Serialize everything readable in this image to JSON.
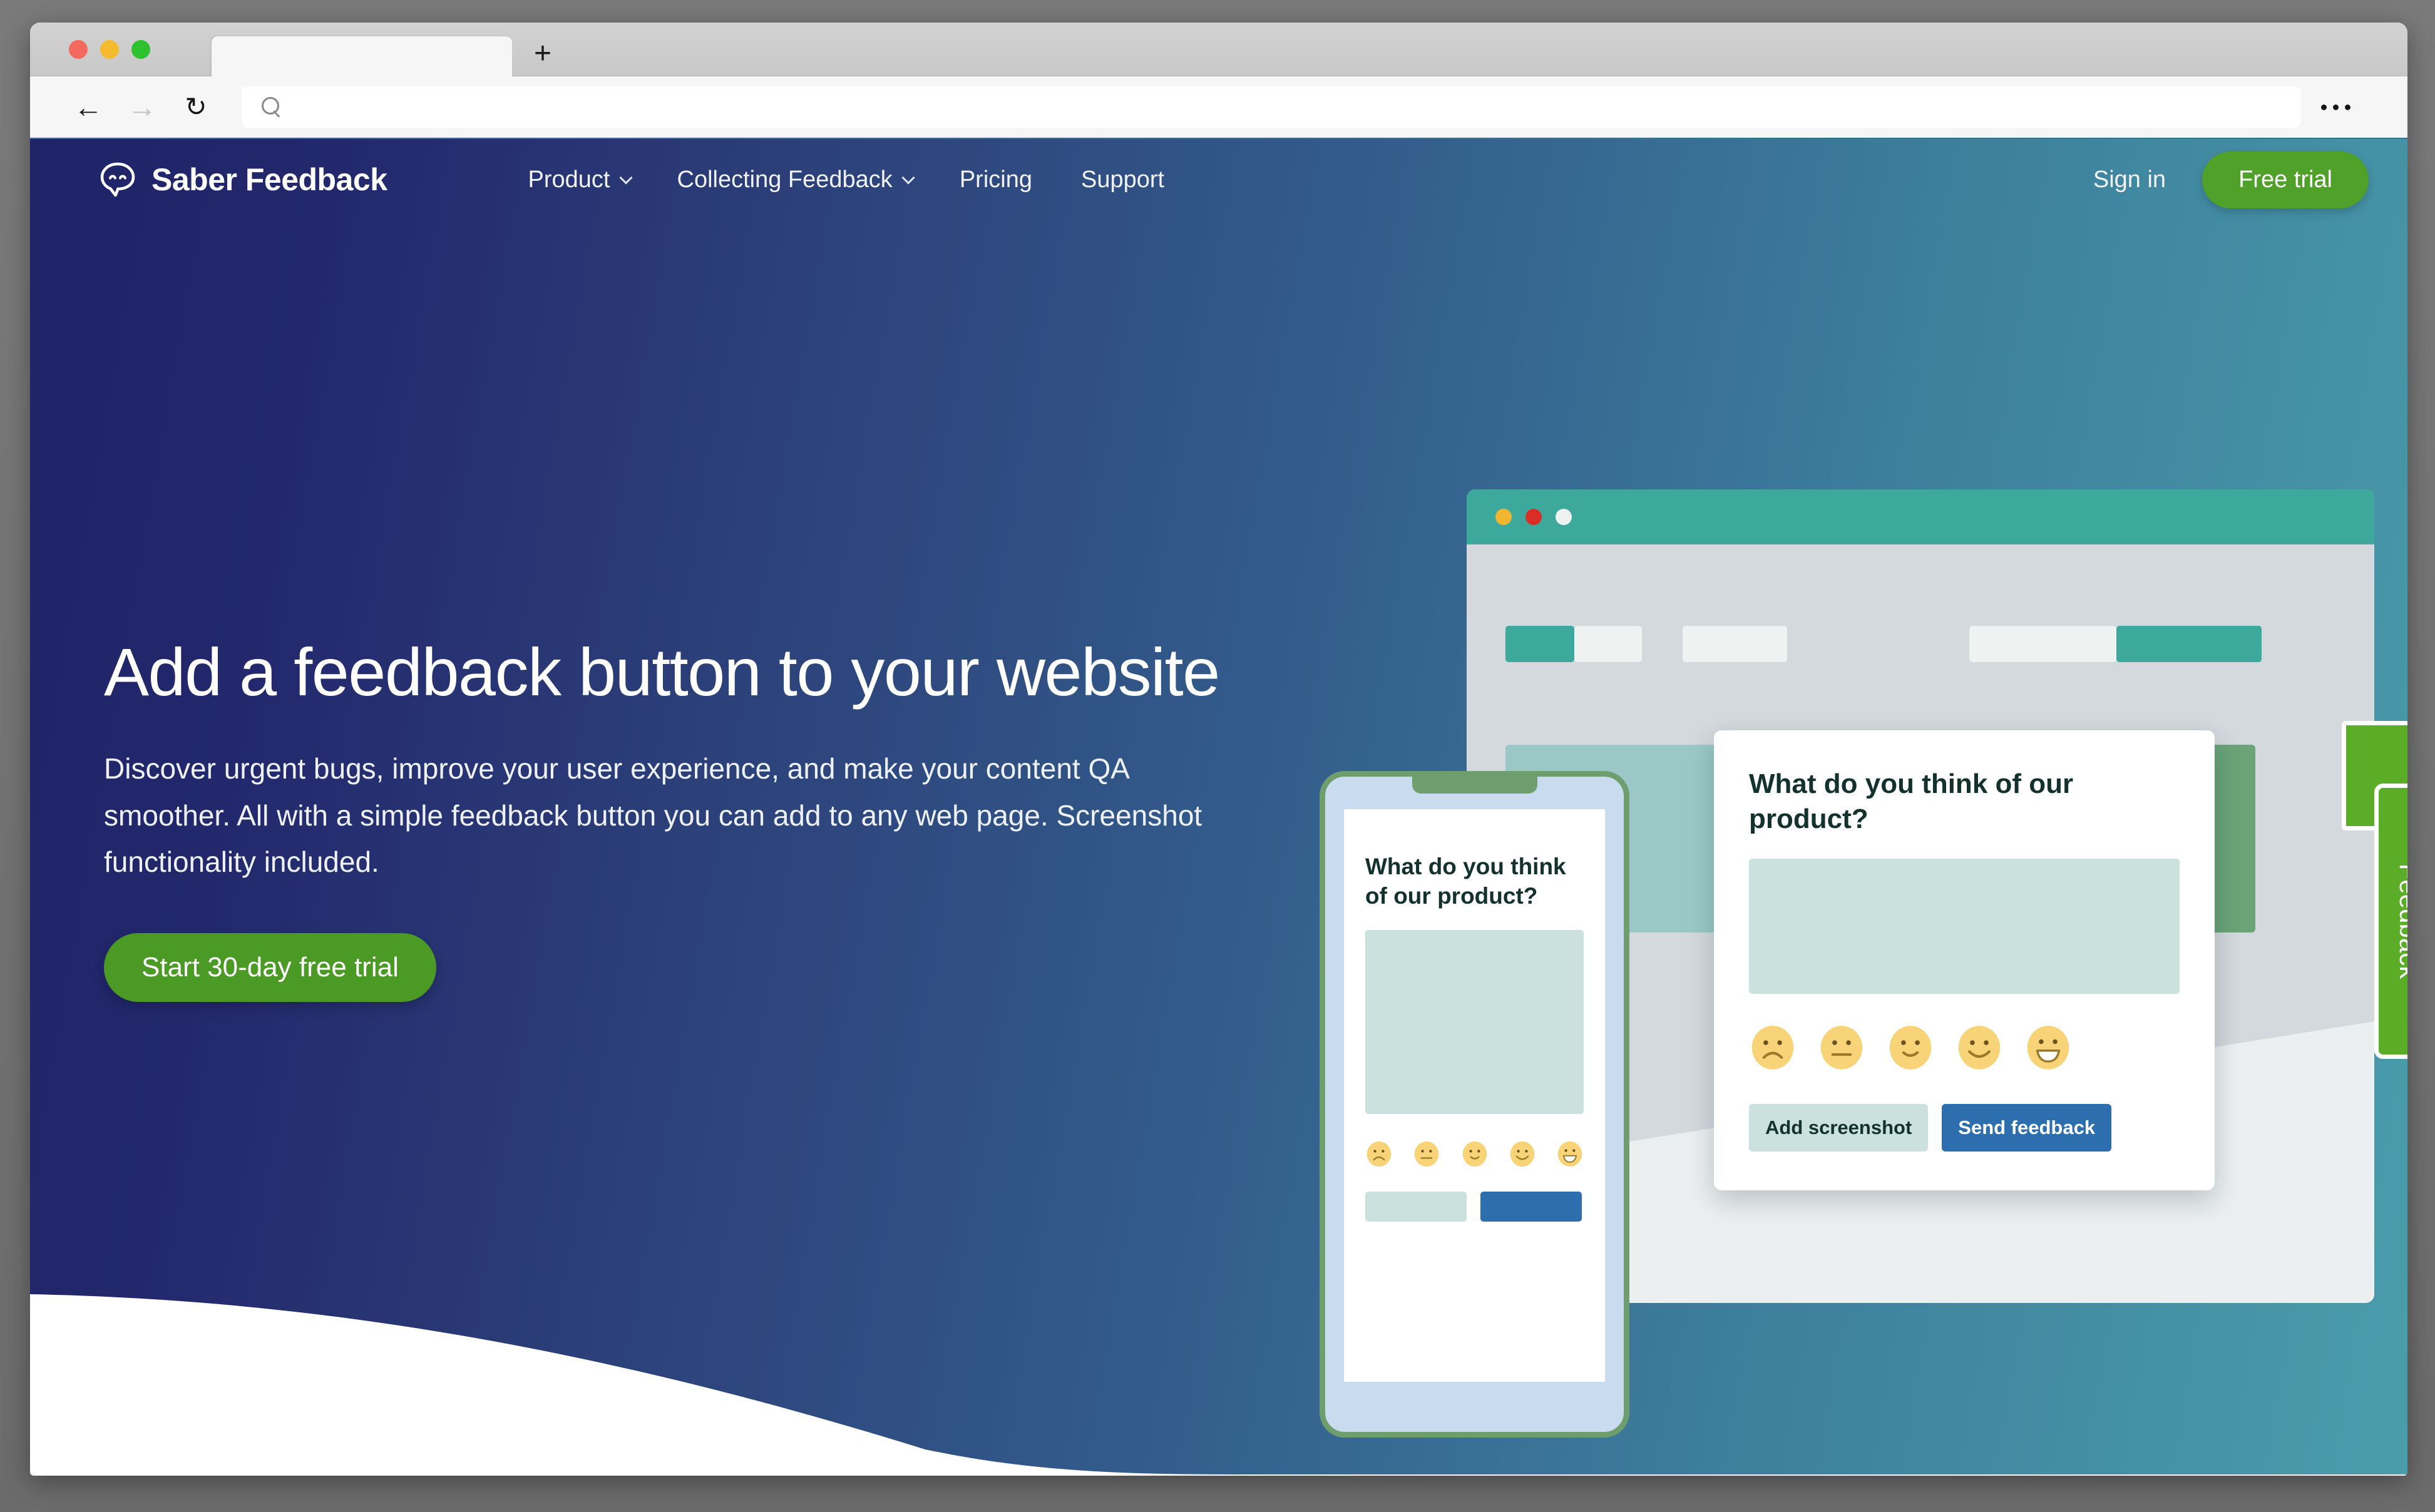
{
  "browser": {
    "traffic_lights": [
      "close",
      "minimize",
      "maximize"
    ],
    "tab_title": "",
    "new_tab_label": "+",
    "back_glyph": "←",
    "forward_glyph": "→",
    "reload_glyph": "↻",
    "url_value": "",
    "url_placeholder": "",
    "overflow_label": "⋯"
  },
  "site": {
    "brand_name": "Saber Feedback",
    "nav": [
      {
        "label": "Product",
        "has_dropdown": true
      },
      {
        "label": "Collecting Feedback",
        "has_dropdown": true
      },
      {
        "label": "Pricing",
        "has_dropdown": false
      },
      {
        "label": "Support",
        "has_dropdown": false
      }
    ],
    "signin_label": "Sign in",
    "free_trial_label": "Free trial"
  },
  "hero": {
    "title": "Add a feedback button to your website",
    "subtitle": "Discover urgent bugs, improve your user experience, and make your content QA smoother. All with a simple feedback button you can add to any web page. Screenshot functionality included.",
    "cta_label": "Start 30-day free trial"
  },
  "illustration": {
    "feedback_tab_label": "Feedback",
    "widget": {
      "title": "What do you think of our product?",
      "comment_value": "",
      "ratings": [
        "sad-face",
        "neutral-face",
        "slight-smile-face",
        "smile-face",
        "grin-face"
      ],
      "screenshot_button_label": "Add screenshot",
      "send_button_label": "Send feedback"
    },
    "phone": {
      "title": "What do you think of our product?",
      "comment_value": "",
      "ratings": [
        "sad-face",
        "neutral-face",
        "slight-smile-face",
        "smile-face",
        "grin-face"
      ]
    },
    "mock_browser_dots": [
      "yellow",
      "red",
      "white"
    ]
  },
  "colors": {
    "brand_green": "#50a129",
    "cta_green": "#4a9a25",
    "tab_green": "#5bac27",
    "send_blue": "#2d6eae",
    "mint": "#cbe1de",
    "teal": "#3da99d",
    "hero_gradient_start": "#1f2367",
    "hero_gradient_end": "#4a9dab",
    "emoji_yellow": "#f9d377"
  }
}
